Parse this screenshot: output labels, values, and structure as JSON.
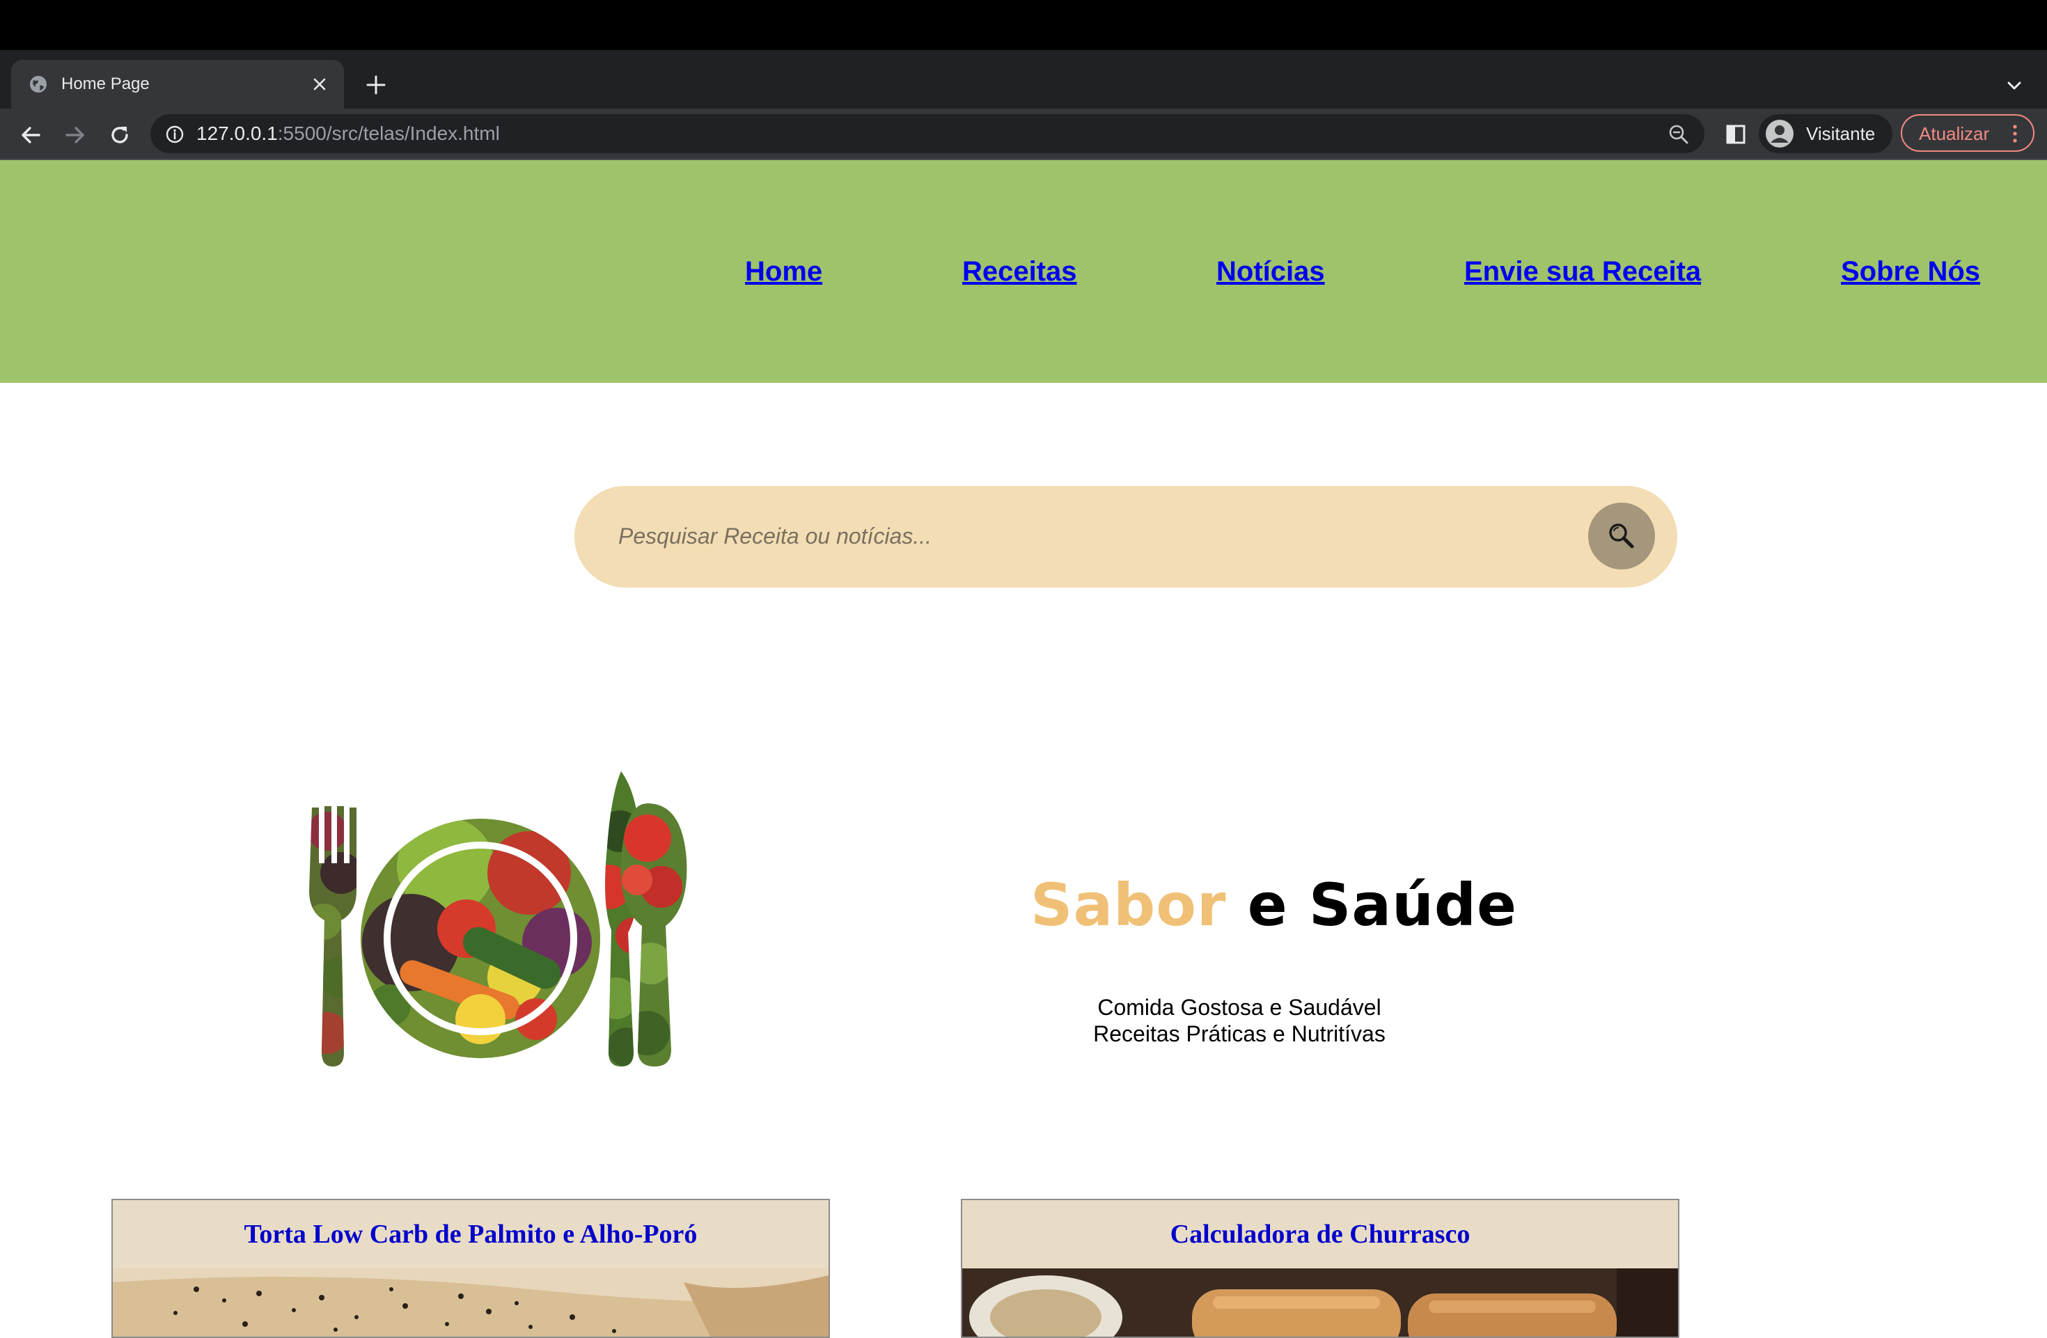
{
  "browser": {
    "tab": {
      "title": "Home Page",
      "favicon": "globe-icon"
    },
    "url_host": "127.0.0.1",
    "url_path": ":5500/src/telas/Index.html",
    "profile_label": "Visitante",
    "update_label": "Atualizar"
  },
  "nav": {
    "links": [
      "Home",
      "Receitas",
      "Notícias",
      "Envie sua Receita",
      "Sobre Nós"
    ]
  },
  "search": {
    "placeholder": "Pesquisar Receita ou notícias...",
    "icon": "search-icon"
  },
  "hero": {
    "brand_first": "Sabor",
    "brand_rest": " e Saúde",
    "tagline_line1": "Comida Gostosa e Saudável",
    "tagline_line2": "Receitas Práticas e Nutritívas"
  },
  "cards": [
    {
      "title": "Torta Low Carb de Palmito e Alho-Poró"
    },
    {
      "title": "Calculadora de Churrasco"
    }
  ],
  "colors": {
    "header_bg": "#9fc36b",
    "search_bg": "#f3ddb4",
    "search_button": "#a5977b",
    "brand_accent": "#f0c076",
    "card_header_bg": "#e9dcc6",
    "link": "#0000ee"
  }
}
